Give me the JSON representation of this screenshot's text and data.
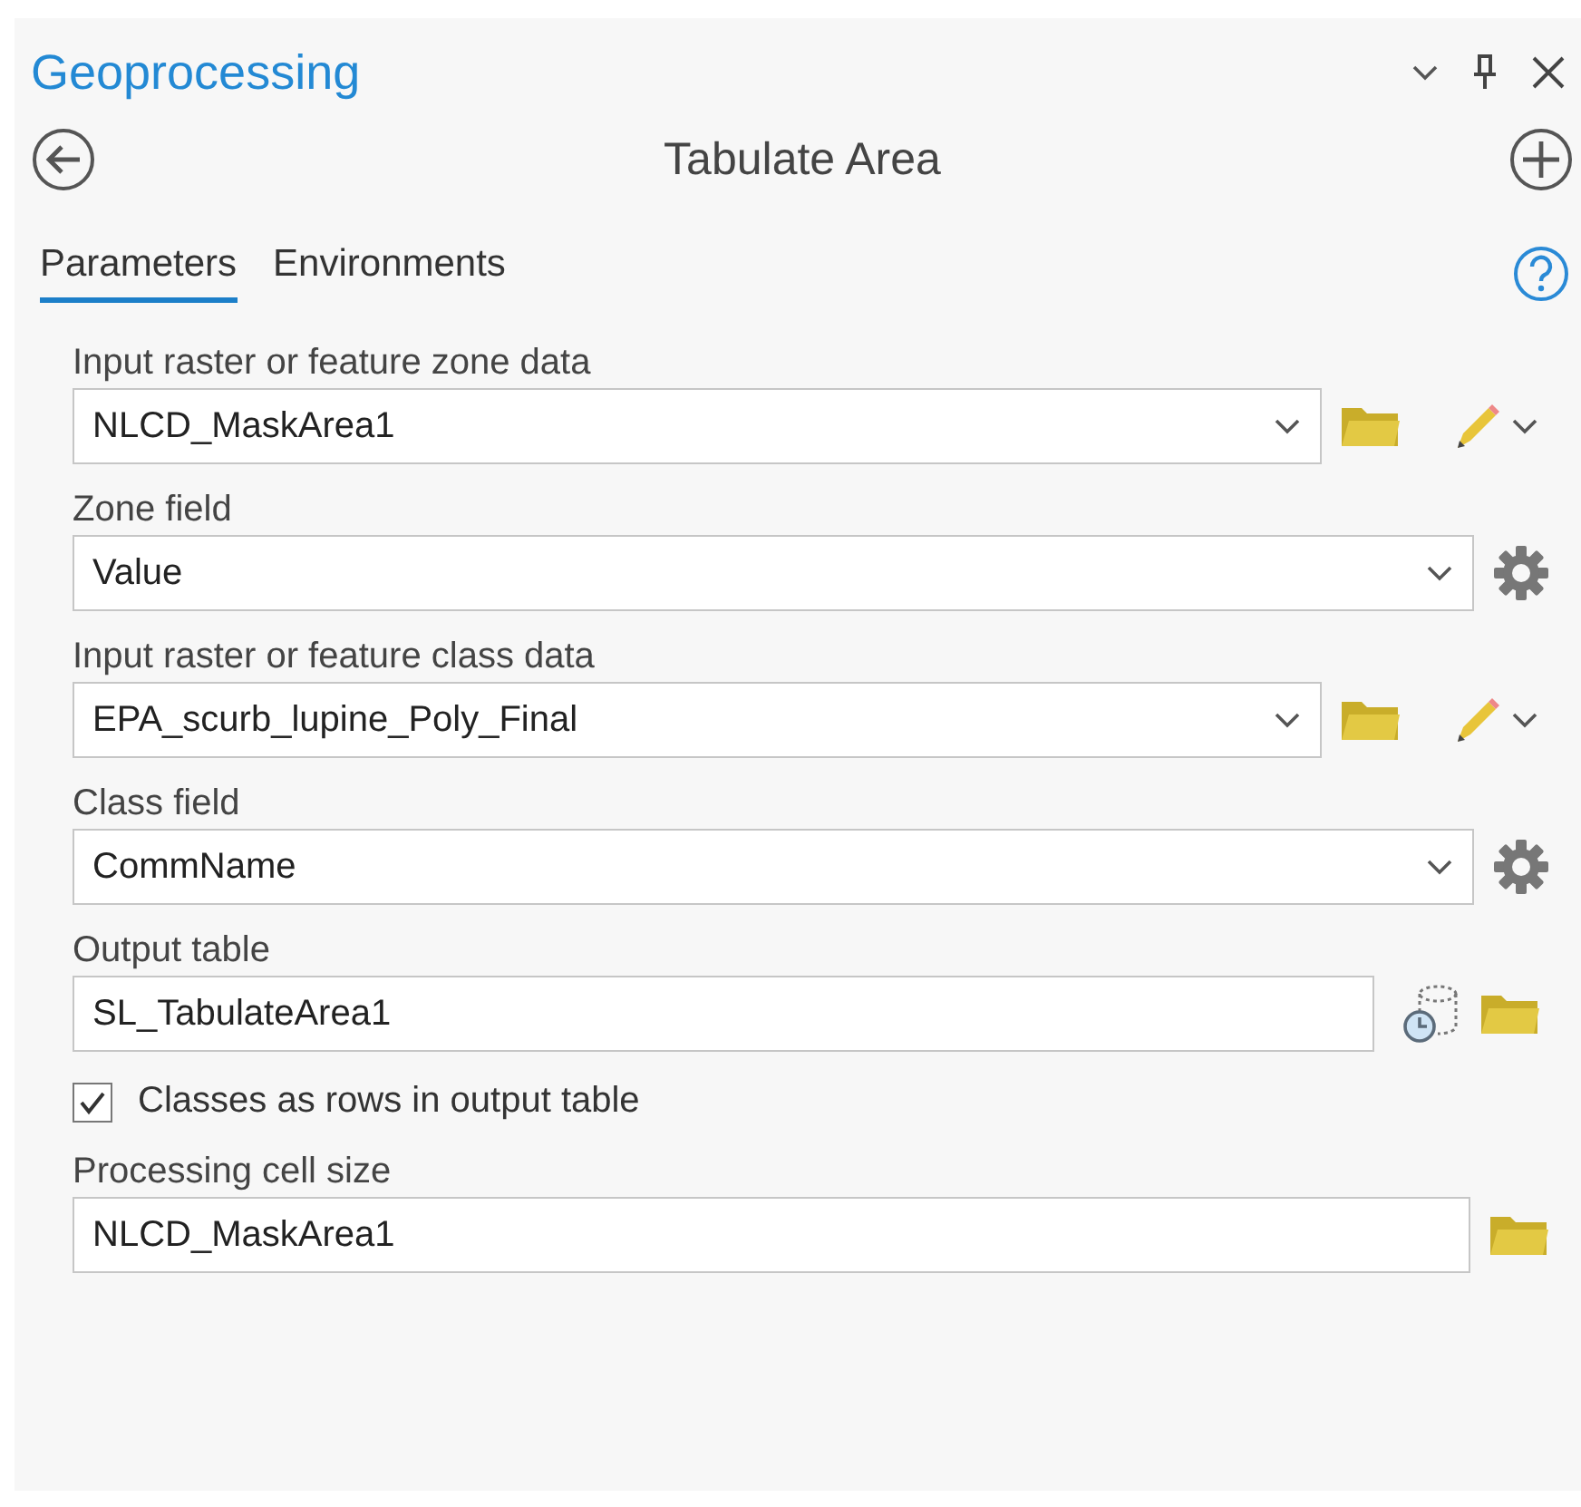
{
  "pane": {
    "title": "Geoprocessing"
  },
  "tool": {
    "title": "Tabulate Area"
  },
  "tabs": [
    {
      "label": "Parameters",
      "selected": true
    },
    {
      "label": "Environments",
      "selected": false
    }
  ],
  "parameters": [
    {
      "kind": "layer",
      "label": "Input raster or feature zone data",
      "value": "NLCD_MaskArea1"
    },
    {
      "kind": "field",
      "label": "Zone field",
      "value": "Value"
    },
    {
      "kind": "layer",
      "label": "Input raster or feature class data",
      "value": "EPA_scurb_lupine_Poly_Final"
    },
    {
      "kind": "field",
      "label": "Class field",
      "value": "CommName"
    },
    {
      "kind": "output",
      "label": "Output table",
      "value": "SL_TabulateArea1"
    },
    {
      "kind": "checkbox",
      "label": "Classes as rows in output table",
      "checked": true
    },
    {
      "kind": "cellsize",
      "label": "Processing cell size",
      "value": "NLCD_MaskArea1"
    }
  ]
}
